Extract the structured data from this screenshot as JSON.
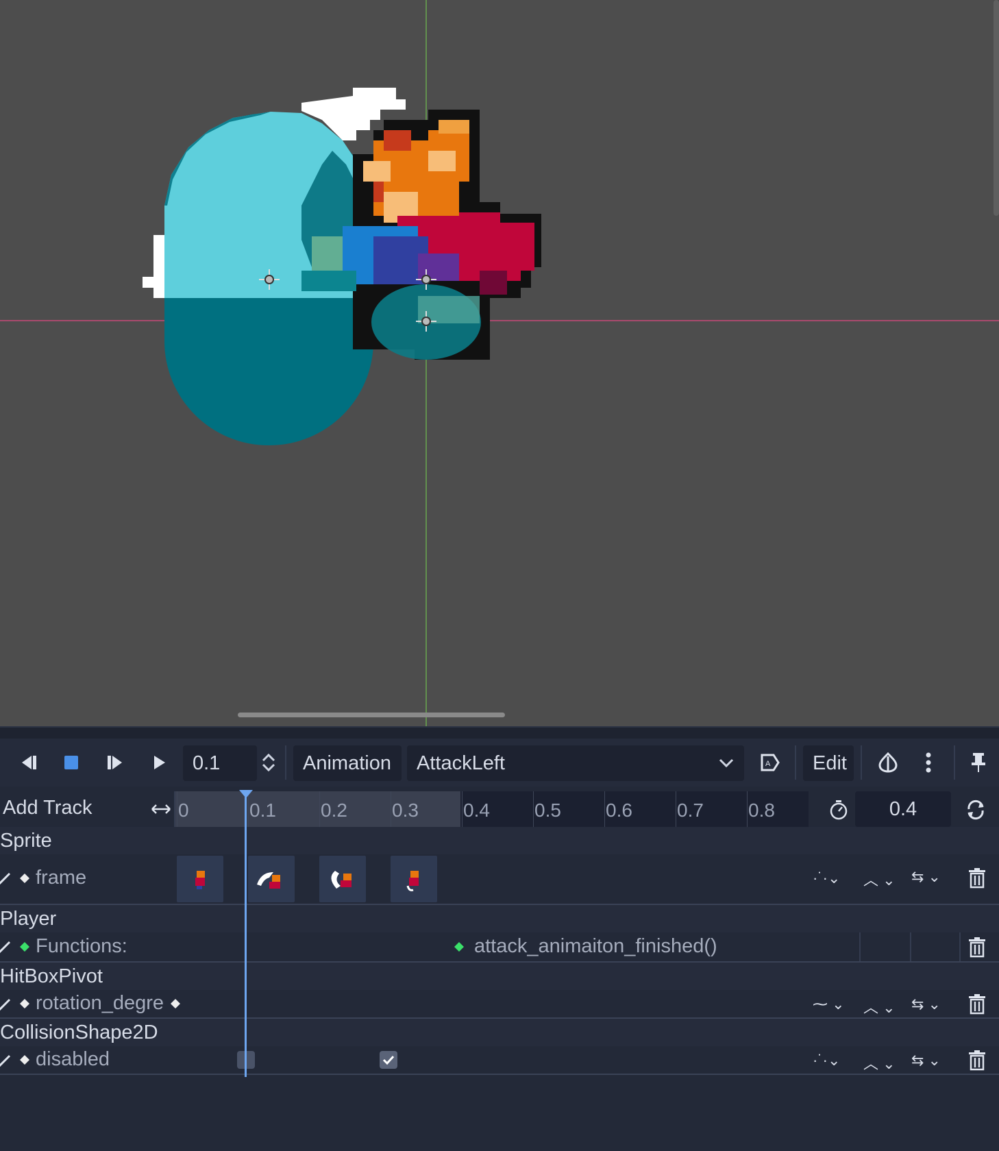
{
  "toolbar": {
    "play_backwards_icon": "play-backwards-icon",
    "stop_icon": "stop-icon",
    "step_icon": "step-icon",
    "play_icon": "play-icon",
    "time_value": "0.1",
    "animation_label": "Animation",
    "animation_name": "AttackLeft",
    "edit_label": "Edit"
  },
  "timeline": {
    "add_track_label": "Add Track",
    "ticks": [
      "0",
      "0.1",
      "0.2",
      "0.3",
      "0.4",
      "0.5",
      "0.6",
      "0.7",
      "0.8"
    ],
    "length_value": "0.4",
    "current_time": 0.1
  },
  "tracks": {
    "sprite": {
      "node": "Sprite",
      "property": "frame"
    },
    "player": {
      "node": "Player",
      "property": "Functions:",
      "method_key": "attack_animaiton_finished()"
    },
    "hitbox": {
      "node": "HitBoxPivot",
      "property": "rotation_degre"
    },
    "collision": {
      "node": "CollisionShape2D",
      "property": "disabled"
    }
  },
  "colors": {
    "viewport_bg": "#4d4d4d",
    "panel_bg": "#232938",
    "accent": "#6ea6f0",
    "method_key": "#3be06a",
    "axis_x": "#c84a7a",
    "axis_y": "#6aa84f"
  }
}
